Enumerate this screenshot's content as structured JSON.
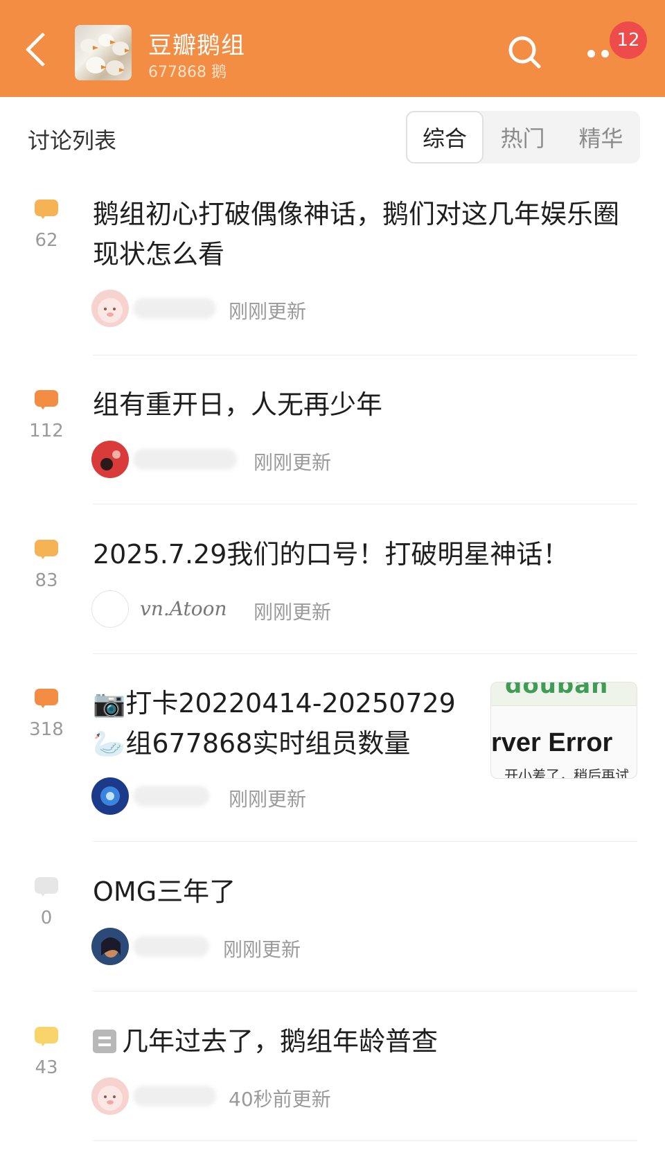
{
  "header": {
    "group_name": "豆瓣鹅组",
    "member_count": "677868 鹅",
    "notification_badge": "12",
    "accent_color": "#f28d43"
  },
  "section": {
    "title": "讨论列表",
    "tabs": [
      {
        "label": "综合",
        "active": true
      },
      {
        "label": "热门",
        "active": false
      },
      {
        "label": "精华",
        "active": false
      }
    ]
  },
  "posts": [
    {
      "title": "鹅组初心打破偶像神话，鹅们对这几年娱乐圈现状怎么看",
      "comments": "62",
      "icon_color": "#f6b355",
      "username": "",
      "updated": "刚刚更新"
    },
    {
      "title": "组有重开日，人无再少年",
      "comments": "112",
      "icon_color": "#f28d43",
      "username": "",
      "updated": "刚刚更新"
    },
    {
      "title": "2025.7.29我们的口号！打破明星神话！",
      "comments": "83",
      "icon_color": "#f6b355",
      "username": "vn.Atoon",
      "updated": "刚刚更新"
    },
    {
      "title_line1": "📷打卡20220414-20250729",
      "title_line2": "🦢组677868实时组员数量",
      "comments": "318",
      "icon_color": "#f28d43",
      "username": "",
      "updated": "刚刚更新",
      "thumbnail": {
        "brand": "douban",
        "error_text": "rver Error",
        "fragment": "...开小差了，稍后再试"
      }
    },
    {
      "title": "OMG三年了",
      "comments": "0",
      "icon_color": "#e6e6e6",
      "username": "",
      "updated": "刚刚更新"
    },
    {
      "title": "几年过去了，鹅组年龄普查",
      "comments": "43",
      "icon_color": "#f9d46a",
      "username": "",
      "updated": "40秒前更新"
    }
  ]
}
